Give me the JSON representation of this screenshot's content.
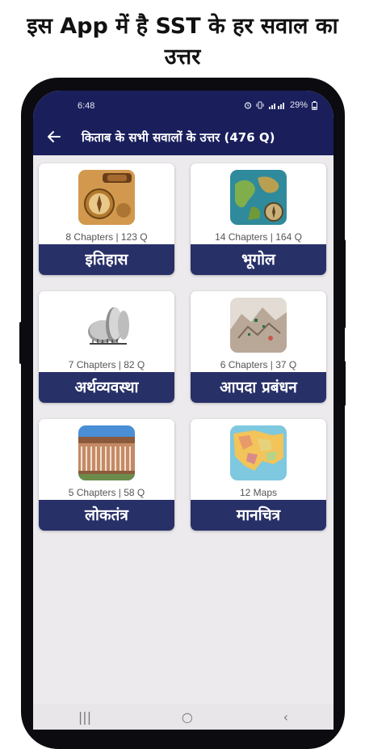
{
  "promo": {
    "line1": "इस App में है SST के हर सवाल का",
    "line2": "उत्तर"
  },
  "status": {
    "time": "6:48",
    "battery": "29%",
    "icons": [
      "alarm-icon",
      "vibrate-icon",
      "signal-icon",
      "battery-icon"
    ]
  },
  "appbar": {
    "title": "किताब के सभी सवालों के उत्तर (476 Q)",
    "back_icon": "back-arrow-icon"
  },
  "cards": [
    {
      "label": "इतिहास",
      "meta": "8 Chapters | 123 Q",
      "image": "compass-map-image"
    },
    {
      "label": "भूगोल",
      "meta": "14 Chapters | 164 Q",
      "image": "globe-map-image"
    },
    {
      "label": "अर्थव्यवस्था",
      "meta": "7 Chapters | 82 Q",
      "image": "coins-image"
    },
    {
      "label": "आपदा प्रबंधन",
      "meta": "6 Chapters | 37 Q",
      "image": "disaster-image"
    },
    {
      "label": "लोकतंत्र",
      "meta": "5 Chapters | 58 Q",
      "image": "parliament-image"
    },
    {
      "label": "मानचित्र",
      "meta": "12 Maps",
      "image": "map-image"
    }
  ],
  "navbar": {
    "recent": "|||",
    "home": "○",
    "back": "‹"
  },
  "colors": {
    "primary": "#1a1f5c",
    "card_label": "#283068",
    "background": "#eceaec"
  }
}
